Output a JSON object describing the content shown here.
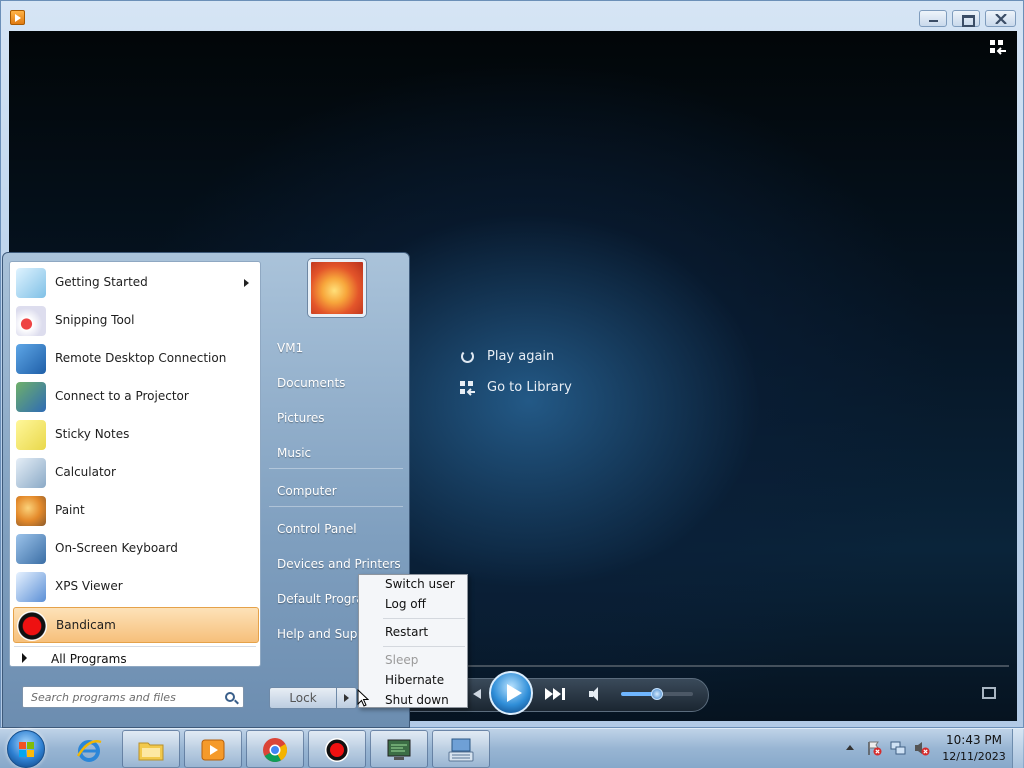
{
  "window": {
    "icon": "media-player-icon",
    "controls": [
      "minimize-icon",
      "maximize-icon",
      "close-icon"
    ]
  },
  "player": {
    "options": [
      {
        "label": "Play again",
        "icon": "replay-icon"
      },
      {
        "label": "Go to Library",
        "icon": "library-icon"
      }
    ],
    "volume_level": 0.5,
    "accent_color": "#2f8ed8"
  },
  "start_menu": {
    "programs": [
      {
        "label": "Getting Started",
        "icon": "getting-started-icon",
        "has_submenu": true
      },
      {
        "label": "Snipping Tool",
        "icon": "scissors-icon"
      },
      {
        "label": "Remote Desktop Connection",
        "icon": "remote-desktop-icon"
      },
      {
        "label": "Connect to a Projector",
        "icon": "projector-icon"
      },
      {
        "label": "Sticky Notes",
        "icon": "sticky-notes-icon"
      },
      {
        "label": "Calculator",
        "icon": "calculator-icon"
      },
      {
        "label": "Paint",
        "icon": "paint-palette-icon"
      },
      {
        "label": "On-Screen Keyboard",
        "icon": "keyboard-icon"
      },
      {
        "label": "XPS Viewer",
        "icon": "xps-viewer-icon"
      },
      {
        "label": "Bandicam",
        "icon": "bandicam-record-icon",
        "selected": true
      }
    ],
    "all_programs": "All Programs",
    "search_placeholder": "Search programs and files",
    "right_links": [
      "VM1",
      "Documents",
      "Pictures",
      "Music",
      "Computer",
      "Control Panel",
      "Devices and Printers",
      "Default Programs",
      "Help and Support"
    ],
    "lock_label": "Lock",
    "power_menu": [
      {
        "label": "Switch user",
        "enabled": true
      },
      {
        "label": "Log off",
        "enabled": true
      },
      {
        "label": "Restart",
        "enabled": true
      },
      {
        "label": "Sleep",
        "enabled": false
      },
      {
        "label": "Hibernate",
        "enabled": true
      },
      {
        "label": "Shut down",
        "enabled": true
      }
    ],
    "selected_color": "#f6c07b"
  },
  "taskbar": {
    "items": [
      {
        "name": "internet-explorer",
        "icon": "internet-explorer-icon",
        "state": "pinned"
      },
      {
        "name": "windows-explorer",
        "icon": "folder-icon",
        "state": "open"
      },
      {
        "name": "windows-media-player",
        "icon": "media-player-icon",
        "state": "open"
      },
      {
        "name": "google-chrome",
        "icon": "chrome-icon",
        "state": "open"
      },
      {
        "name": "bandicam",
        "icon": "bandicam-record-icon",
        "state": "open"
      },
      {
        "name": "screen-app",
        "icon": "monitor-icon",
        "state": "open"
      },
      {
        "name": "on-screen-keyboard",
        "icon": "keyboard-icon",
        "state": "open"
      }
    ],
    "tray_icons": [
      "action-center-flag-icon",
      "network-icon",
      "volume-muted-icon"
    ],
    "clock_time": "10:43 PM",
    "clock_date": "12/11/2023"
  }
}
